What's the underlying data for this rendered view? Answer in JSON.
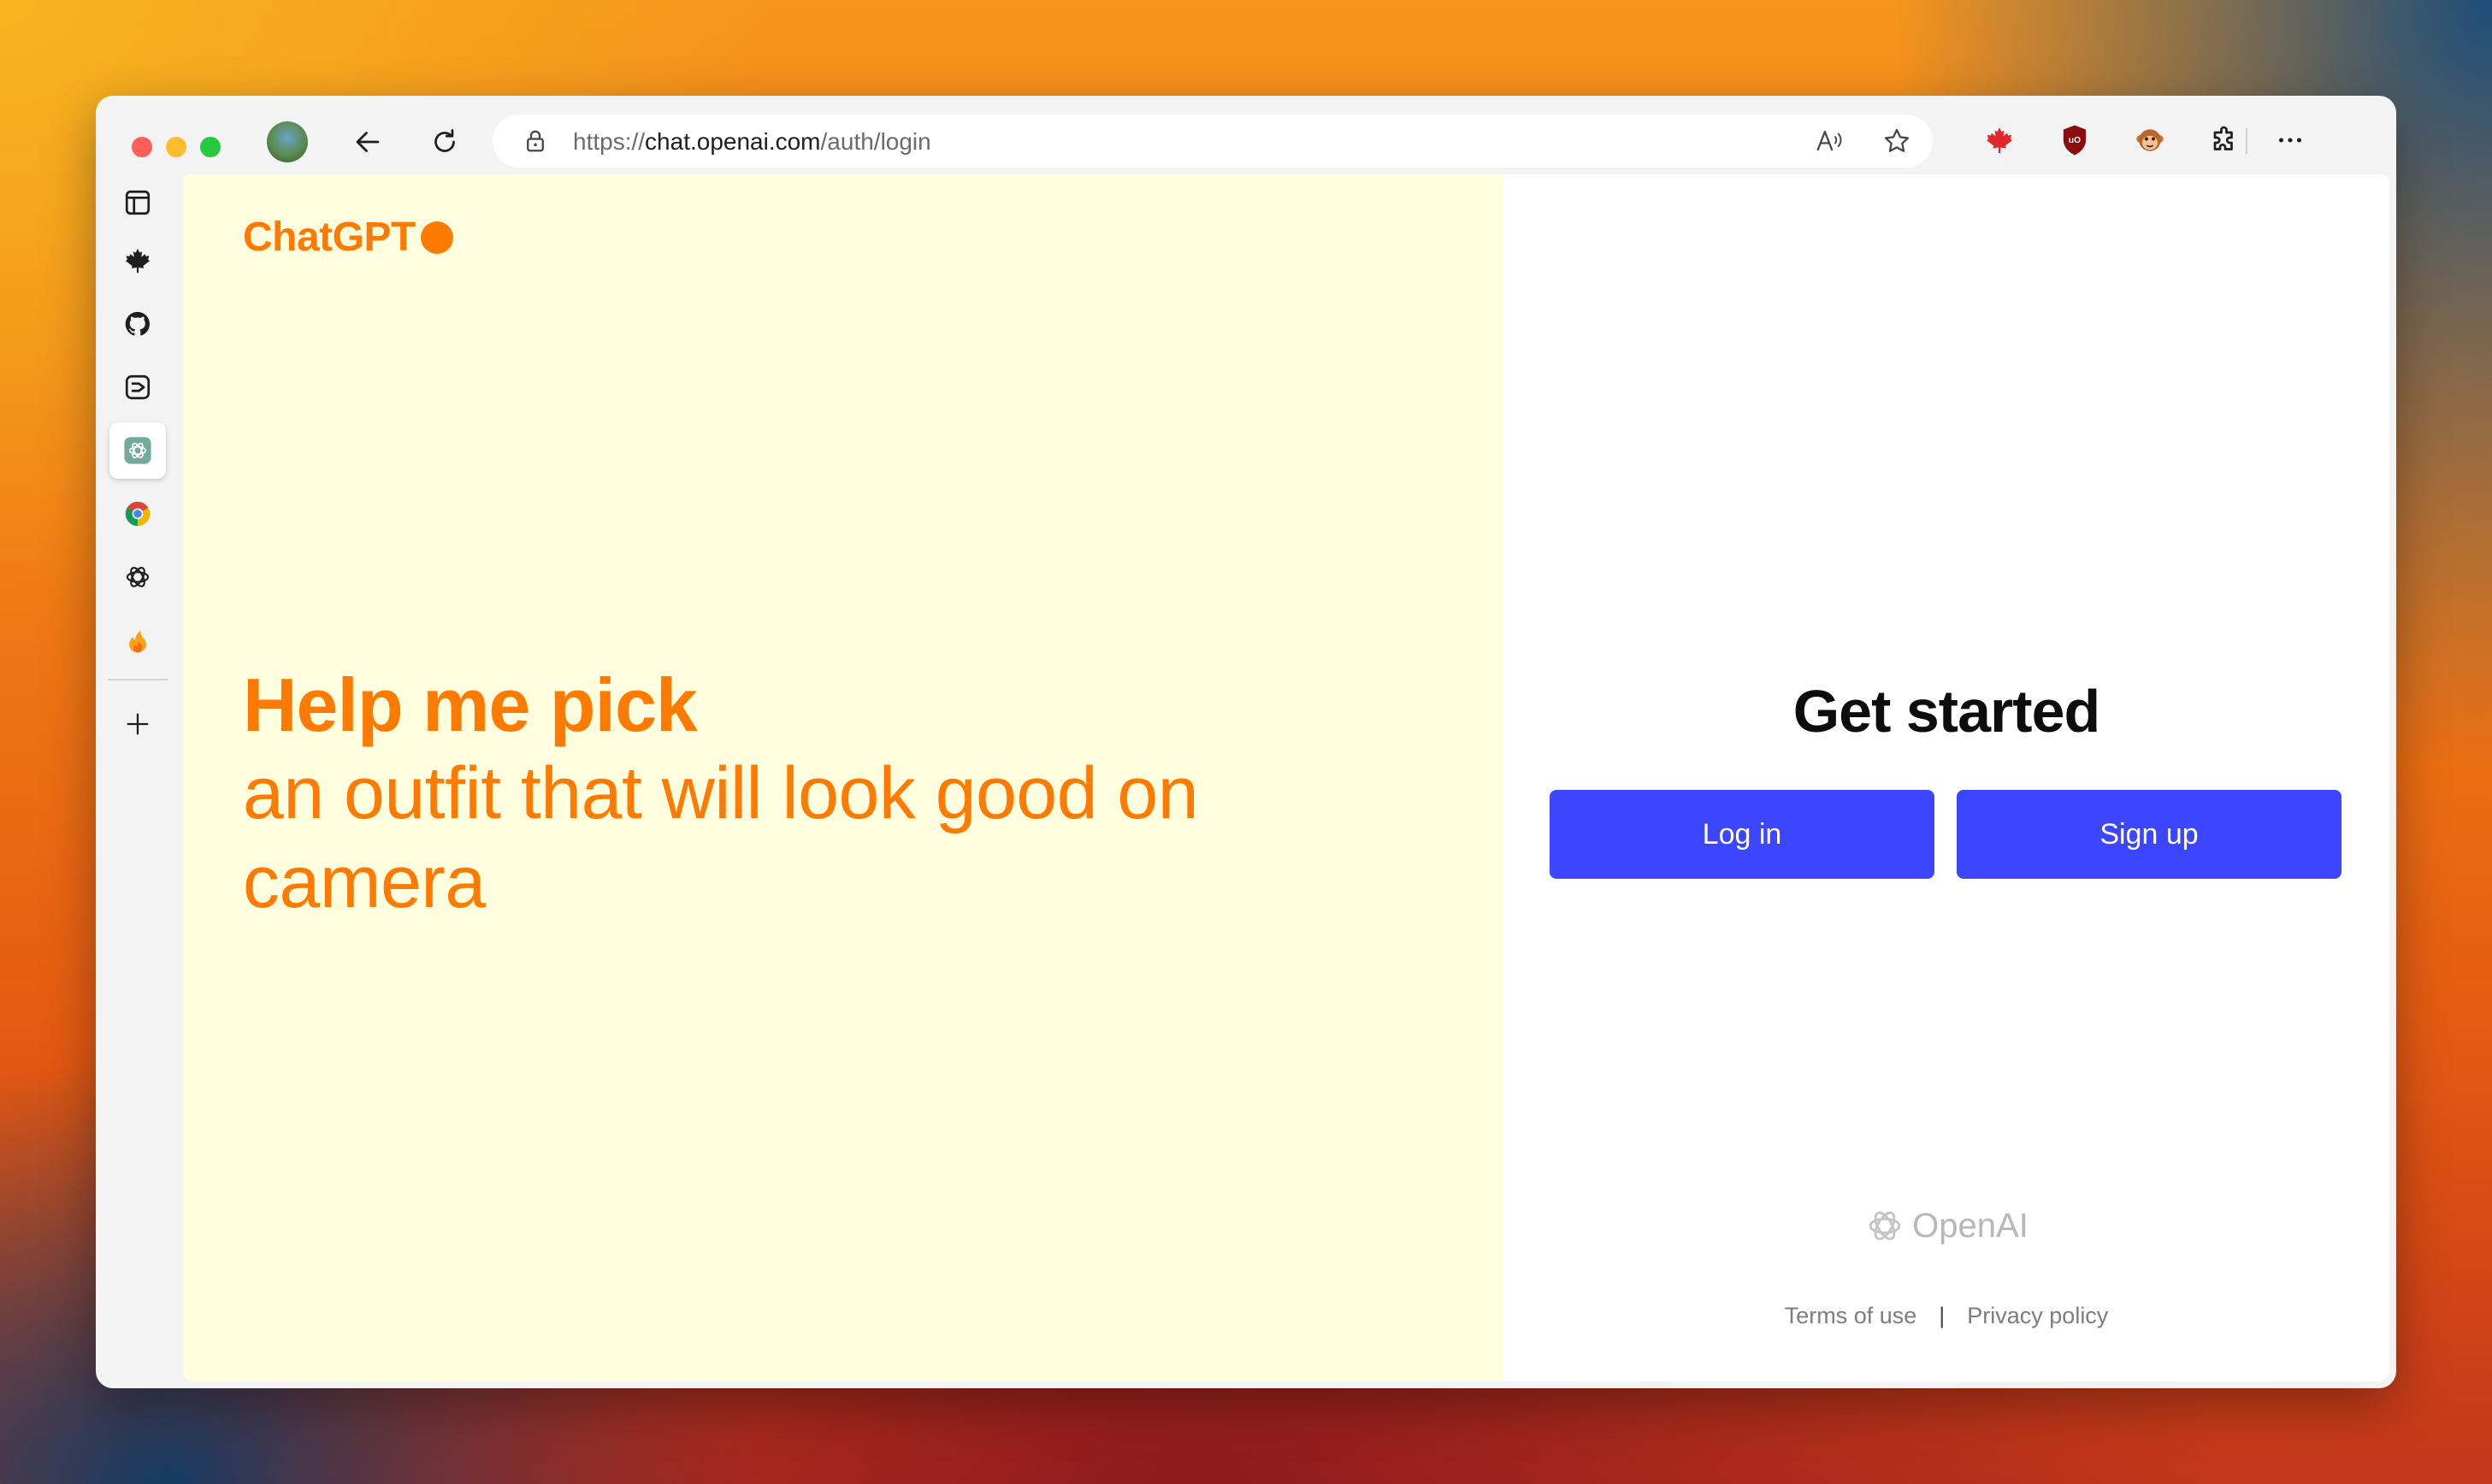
{
  "browser": {
    "url_prefix": "https://",
    "url_host": "chat.openai.com",
    "url_path": "/auth/login"
  },
  "sidebar": {
    "items": [
      {
        "name": "tabs-panel-icon"
      },
      {
        "name": "maple-leaf-icon"
      },
      {
        "name": "github-icon"
      },
      {
        "name": "deepl-icon"
      },
      {
        "name": "chatgpt-icon",
        "active": true
      },
      {
        "name": "chrome-color-icon"
      },
      {
        "name": "openai-icon"
      },
      {
        "name": "fire-icon"
      }
    ],
    "add_label": "+"
  },
  "page": {
    "brand": "ChatGPT",
    "hero_bold": "Help me pick",
    "hero_rest": "an outfit that will look good on camera",
    "heading": "Get started",
    "login_label": "Log in",
    "signup_label": "Sign up",
    "footer_logo": "OpenAI",
    "terms_label": "Terms of use",
    "separator": "|",
    "privacy_label": "Privacy policy"
  },
  "colors": {
    "accent_orange": "#ff7a00",
    "left_bg": "#ffffe0",
    "button_blue": "#3c46ff"
  }
}
